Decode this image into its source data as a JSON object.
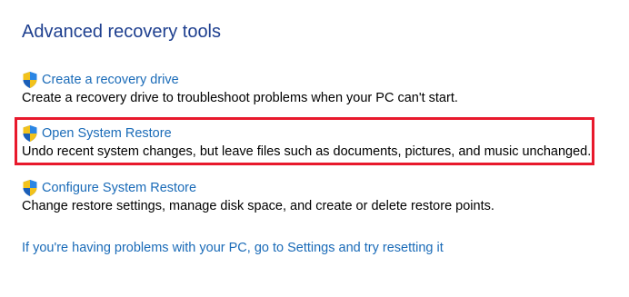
{
  "page": {
    "title": "Advanced recovery tools"
  },
  "tools": [
    {
      "icon": "uac-shield-icon",
      "link_label": "Create a recovery drive",
      "description": "Create a recovery drive to troubleshoot problems when your PC can't start."
    },
    {
      "icon": "uac-shield-icon",
      "link_label": "Open System Restore",
      "description": "Undo recent system changes, but leave files such as documents, pictures, and music unchanged.",
      "highlighted": true
    },
    {
      "icon": "uac-shield-icon",
      "link_label": "Configure System Restore",
      "description": "Change restore settings, manage disk space, and create or delete restore points."
    }
  ],
  "footer": {
    "settings_link": "If you're having problems with your PC, go to Settings and try resetting it"
  },
  "colors": {
    "title": "#1e3f8f",
    "link": "#1a6bb8",
    "highlight": "#e8192c"
  }
}
